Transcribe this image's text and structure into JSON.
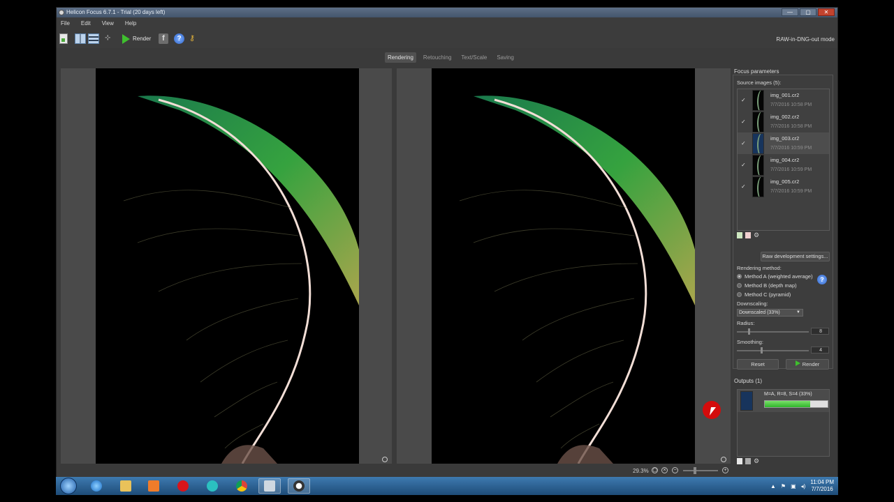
{
  "window": {
    "title": "Helicon Focus 6.7.1 - Trial (20 days left)",
    "controls": [
      "—",
      "▢",
      "✕"
    ]
  },
  "menu": [
    "File",
    "Edit",
    "View",
    "Help"
  ],
  "toolbar": {
    "render_label": "Render",
    "raw_mode": "RAW-in-DNG-out mode",
    "icons": [
      "new-document-icon",
      "split-view-icon",
      "stack-view-icon",
      "mode-icon",
      "render-play-icon",
      "facebook-icon",
      "help-icon",
      "key-icon"
    ]
  },
  "tabs": [
    {
      "label": "Rendering",
      "active": true
    },
    {
      "label": "Retouching",
      "active": false
    },
    {
      "label": "Text/Scale",
      "active": false
    },
    {
      "label": "Saving",
      "active": false
    }
  ],
  "status": {
    "zoom": "29.3%"
  },
  "focus_panel": {
    "title": "Focus parameters",
    "source_label": "Source images (5):",
    "sources": [
      {
        "name": "img_001.cr2",
        "date": "7/7/2016 10:58 PM",
        "checked": true,
        "selected": false
      },
      {
        "name": "img_002.cr2",
        "date": "7/7/2016 10:58 PM",
        "checked": true,
        "selected": false
      },
      {
        "name": "img_003.cr2",
        "date": "7/7/2016 10:59 PM",
        "checked": true,
        "selected": true
      },
      {
        "name": "img_004.cr2",
        "date": "7/7/2016 10:59 PM",
        "checked": true,
        "selected": false
      },
      {
        "name": "img_005.cr2",
        "date": "7/7/2016 10:59 PM",
        "checked": true,
        "selected": false
      }
    ],
    "raw_button": "Raw development settings...",
    "rendering_label": "Rendering method:",
    "methods": [
      {
        "label": "Method A (weighted average)",
        "selected": true
      },
      {
        "label": "Method B (depth map)",
        "selected": false
      },
      {
        "label": "Method C (pyramid)",
        "selected": false
      }
    ],
    "downscaling_label": "Downscaling:",
    "downscaling_value": "Downscaled (33%)",
    "radius_label": "Radius:",
    "radius_value": "8",
    "smoothing_label": "Smoothing:",
    "smoothing_value": "4",
    "reset_button": "Reset",
    "render_button": "Render"
  },
  "outputs": {
    "title": "Outputs (1)",
    "items": [
      {
        "label": "M=A, R=8, S=4 (33%)",
        "progress": 0.72
      }
    ]
  },
  "taskbar": {
    "time": "11:04 PM",
    "date": "7/7/2016"
  },
  "colors": {
    "accent_green": "#3fbf2e",
    "click_marker": "#d40c0c"
  }
}
